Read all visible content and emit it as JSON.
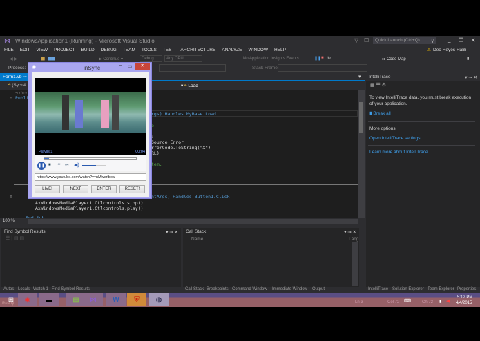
{
  "window": {
    "title": "WindowsApplication1 (Running) - Microsoft Visual Studio",
    "quick_launch": "Quick Launch (Ctrl+Q)",
    "user": "Deo Reyes Halili"
  },
  "menu": [
    "FILE",
    "EDIT",
    "VIEW",
    "PROJECT",
    "BUILD",
    "DEBUG",
    "TEAM",
    "TOOLS",
    "TEST",
    "ARCHITECTURE",
    "ANALYZE",
    "WINDOW",
    "HELP"
  ],
  "toolbar": {
    "continue": "Continue",
    "config": "Debug",
    "platform": "Any CPU",
    "insights": "No Application Insights Events",
    "code_map": "Code Map"
  },
  "debugbar": {
    "process": "Process:",
    "stack_frame": "Stack Frame:"
  },
  "editor": {
    "tab": "Form1.vb",
    "nav_left": "(SycnA",
    "nav_right": "Load",
    "zoom": "100 %",
    "lines": {
      "ref": "~refere",
      "publi": "Publi",
      "l1": "rgs) Handles MyBase.Load",
      "l2": "e",
      "l3": ":",
      "l4": "Source.Error",
      "l5": "rrorCode.ToString(\"X\") _",
      "l6": "RL)",
      "l7": "tem.",
      "l8": "ntArgs) Handles Button1.Click",
      "l9": "AxWindowsMediaPlayer1.Ctlcontrols.stop()",
      "l10": "AxWindowsMediaPlayer1.Ctlcontrols.play()",
      "l11": "End Sub"
    }
  },
  "insync": {
    "title": "inSync",
    "playlist": "Playlist1",
    "time": "00:04",
    "url": "https://www.youtube.com/watch?v=nMwerlbow",
    "volume": 0.6,
    "progress": 0.05,
    "buttons": [
      "LIVE!",
      "NEXT",
      "ENTER",
      "RESET!"
    ]
  },
  "intellitrace": {
    "title": "IntelliTrace",
    "message": "To view IntelliTrace data, you must break execution of your application.",
    "break_all": "Break all",
    "more": "More options:",
    "settings": "Open IntelliTrace settings",
    "learn": "Learn more about IntelliTrace"
  },
  "find_symbol": {
    "title": "Find Symbol Results"
  },
  "call_stack": {
    "title": "Call Stack",
    "col_name": "Name",
    "col_lang": "Lang"
  },
  "bottom_tabs_left": [
    "Autos",
    "Locals",
    "Watch 1",
    "Find Symbol Results"
  ],
  "bottom_tabs_mid": [
    "Call Stack",
    "Breakpoints",
    "Command Window",
    "Immediate Window",
    "Output"
  ],
  "bottom_tabs_right": [
    "IntelliTrace",
    "Solution Explorer",
    "Team Explorer",
    "Properties"
  ],
  "status": {
    "ready": "Ready",
    "ln": "Ln 3",
    "col": "Col 72",
    "ch": "Ch 72"
  },
  "clock": {
    "time": "5:12 PM",
    "date": "4/4/2015"
  }
}
